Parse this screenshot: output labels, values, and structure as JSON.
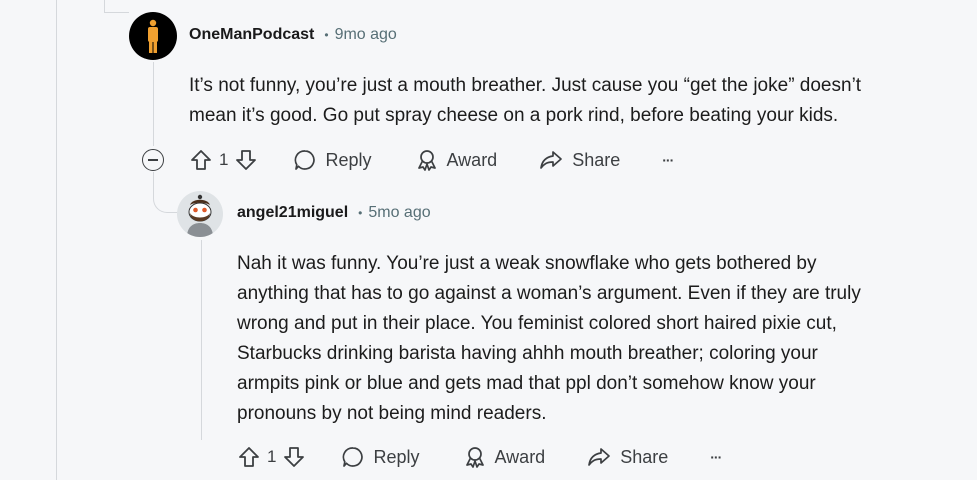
{
  "comments": [
    {
      "username": "OneManPodcast",
      "separator": "•",
      "time": "9mo ago",
      "avatar_icon": "person-silhouette-orange-icon",
      "lines": [
        "It’s not funny, you’re just a mouth breather. Just cause you “get the joke” doesn’t",
        "mean it’s good. Go put spray cheese on a pork rind, before beating your kids."
      ],
      "votes": "1",
      "reply_label": "Reply",
      "award_label": "Award",
      "share_label": "Share",
      "more_label": "···"
    },
    {
      "username": "angel21miguel",
      "separator": "•",
      "time": "5mo ago",
      "avatar_icon": "snoo-bearded-avatar-icon",
      "lines": [
        "Nah it was funny. You’re just a weak snowflake who gets bothered by",
        "anything that has to go against a woman’s argument. Even if they are truly",
        "wrong and put in their place. You feminist colored short haired pixie cut,",
        "Starbucks drinking barista having ahhh mouth breather; coloring your",
        "armpits pink or blue and gets mad that ppl don’t somehow know your",
        "pronouns by not being mind readers."
      ],
      "votes": "1",
      "reply_label": "Reply",
      "award_label": "Award",
      "share_label": "Share",
      "more_label": "···"
    }
  ],
  "colors": {
    "background": "#f6f7f9",
    "thread_line": "#d5d8dc",
    "text": "#1c1c1c",
    "meta": "#576f76",
    "avatar_orange": "#f0a030"
  }
}
